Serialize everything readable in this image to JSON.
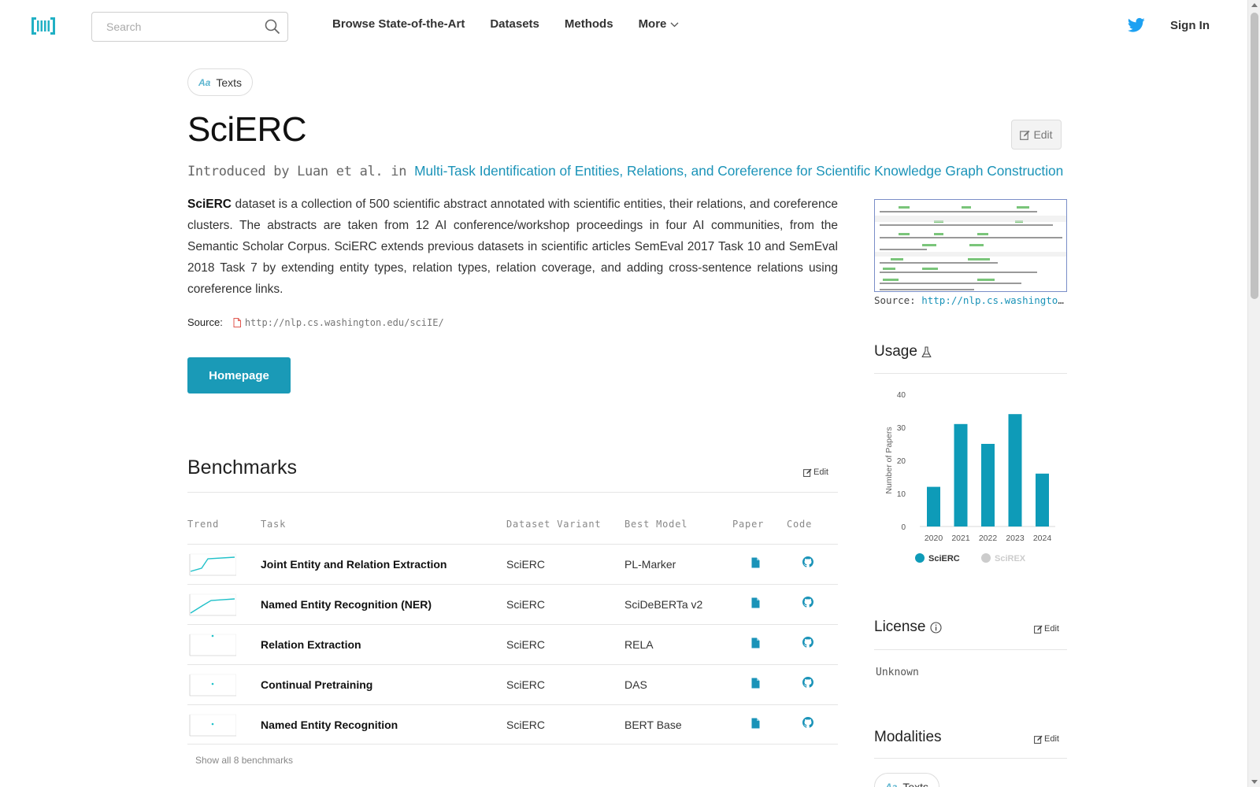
{
  "nav": {
    "search_placeholder": "Search",
    "links": [
      "Browse State-of-the-Art",
      "Datasets",
      "Methods",
      "More"
    ],
    "sign_in": "Sign In"
  },
  "modality_top": "Texts",
  "title": "SciERC",
  "edit_label": "Edit",
  "intro": {
    "prefix": "Introduced by Luan et al. in ",
    "paper_title": "Multi-Task Identification of Entities, Relations, and Coreference for Scientific Knowledge Graph Construction"
  },
  "description": {
    "bold": "SciERC",
    "text": " dataset is a collection of 500 scientific abstract annotated with scientific entities, their relations, and coreference clusters. The abstracts are taken from 12 AI conference/workshop proceedings in four AI communities, from the Semantic Scholar Corpus. SciERC extends previous datasets in scientific articles SemEval 2017 Task 10 and SemEval 2018 Task 7 by extending entity types, relation types, relation coverage, and adding cross-sentence relations using coreference links."
  },
  "source": {
    "label": "Source:",
    "url": "http://nlp.cs.washington.edu/sciIE/"
  },
  "homepage_button": "Homepage",
  "benchmarks": {
    "title": "Benchmarks",
    "edit": "Edit",
    "headers": [
      "Trend",
      "Task",
      "Dataset Variant",
      "Best Model",
      "Paper",
      "Code"
    ],
    "rows": [
      {
        "task": "Joint Entity and Relation Extraction",
        "variant": "SciERC",
        "model": "PL-Marker"
      },
      {
        "task": "Named Entity Recognition (NER)",
        "variant": "SciERC",
        "model": "SciDeBERTa v2"
      },
      {
        "task": "Relation Extraction",
        "variant": "SciERC",
        "model": "RELA"
      },
      {
        "task": "Continual Pretraining",
        "variant": "SciERC",
        "model": "DAS"
      },
      {
        "task": "Named Entity Recognition",
        "variant": "SciERC",
        "model": "BERT Base"
      }
    ],
    "show_all": "Show all 8 benchmarks"
  },
  "sidebar": {
    "image_source_label": "Source:",
    "image_source_url": "http://nlp.cs.washington.edu/sciIE/",
    "usage_title": "Usage",
    "license_title": "License",
    "license_edit": "Edit",
    "license_value": "Unknown",
    "modalities_title": "Modalities",
    "modalities_edit": "Edit",
    "modality": "Texts"
  },
  "colors": {
    "accent": "#1a9ab7",
    "link": "#1a93b8",
    "bar": "#0e9bb8",
    "legend_inactive": "#cccccc"
  },
  "chart_data": {
    "type": "bar",
    "categories": [
      "2020",
      "2021",
      "2022",
      "2023",
      "2024"
    ],
    "series": [
      {
        "name": "SciERC",
        "values": [
          12,
          31,
          25,
          34,
          16
        ],
        "active": true
      },
      {
        "name": "SciREX",
        "values": [],
        "active": false
      }
    ],
    "ylabel": "Number of Papers",
    "ylim": [
      0,
      40
    ],
    "yticks": [
      0,
      10,
      20,
      30,
      40
    ],
    "legend": "bottom",
    "grid": false
  }
}
